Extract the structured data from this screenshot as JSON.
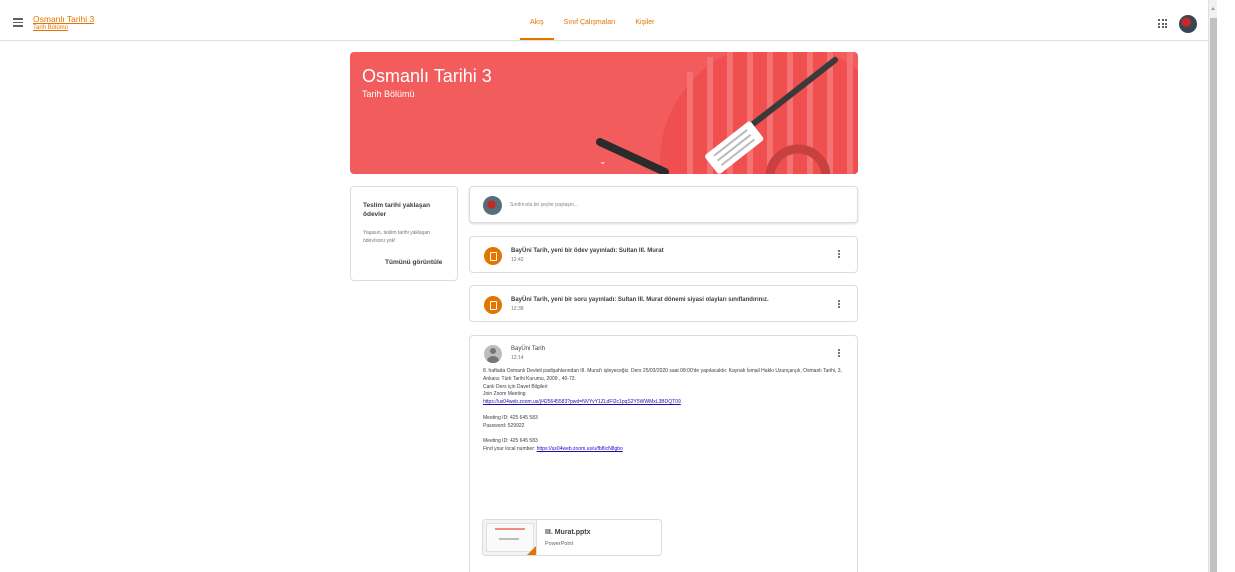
{
  "header": {
    "class_title": "Osmanlı Tarihi 3",
    "class_section": "Tarih Bölümü",
    "tabs": [
      {
        "label": "Akış",
        "active": true
      },
      {
        "label": "Sınıf Çalışmaları",
        "active": false
      },
      {
        "label": "Kişiler",
        "active": false
      }
    ]
  },
  "banner": {
    "title": "Osmanlı Tarihi 3",
    "subtitle": "Tarih Bölümü",
    "color": "#f25c5c"
  },
  "upcoming": {
    "title": "Teslim tarihi yaklaşan ödevler",
    "body": "Yaşasın, teslim tarihi yaklaşan ödev/soru yok!",
    "link": "Tümünü görüntüle"
  },
  "share": {
    "placeholder": "Sınıfınızla bir şeyler paylaşın..."
  },
  "posts": [
    {
      "title": "BayÜni Tarih, yeni bir ödev yayınladı: Sultan III. Murat",
      "time": "12:42",
      "icon": "assignment-icon"
    },
    {
      "title": "BayÜni Tarih, yeni bir soru yayınladı: Sultan III. Murat dönemi siyasi olayları sınıflandırınız.",
      "time": "12:38",
      "icon": "question-icon"
    }
  ],
  "announcement": {
    "author": "BayÜni Tarih",
    "time": "12:14",
    "lines": [
      "8. haftada Osmanlı Devleti padişahlarından III. Murat'ı işleyeceğiz. Ders 25/03/2020 saat 08:00'de yapılacaktır. Kaynak İsmail Hakkı Uzunçarşılı, Osmanlı Tarihi, 3, Ankara: Türk Tarihi Kurumu, 2009 , 40-72.",
      "Canlı Ders için Davet Bilgileri",
      "Join Zoom Meeting"
    ],
    "zoom_link": "https://us04web.zoom.us/j/425645583?pwd=NVYvY1ZLdFI2c1pqS2Y5WWMxL3BDQT09",
    "meeting_id_1": "Meeting ID: 425 645 583",
    "password": "Password: 529922",
    "meeting_id_2": "Meeting ID: 425 645 583",
    "local_number_label": "Find your local number: ",
    "local_number_link": "https://us04web.zoom.us/u/fb8icN8gbo",
    "attachment": {
      "name": "III. Murat.pptx",
      "type": "PowerPoint"
    }
  },
  "colors": {
    "accent": "#e37400",
    "link": "#1a0dab"
  }
}
